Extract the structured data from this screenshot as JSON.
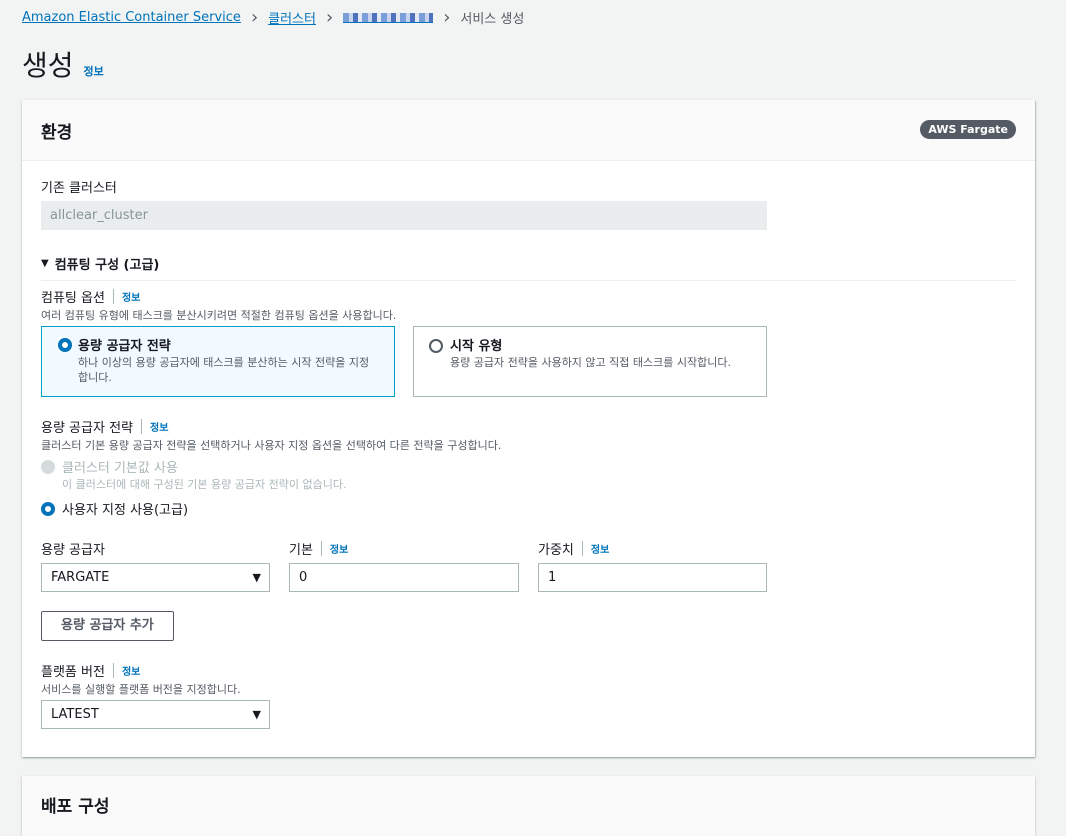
{
  "breadcrumb": {
    "service": "Amazon Elastic Container Service",
    "clusters": "클러스터",
    "current": "서비스 생성"
  },
  "page": {
    "title": "생성",
    "info": "정보"
  },
  "environment": {
    "title": "환경",
    "badge": "AWS Fargate",
    "existing_cluster_label": "기존 클러스터",
    "existing_cluster_value": "allclear_cluster",
    "compute_config_label": "컴퓨팅 구성 (고급)",
    "compute_options": {
      "label": "컴퓨팅 옵션",
      "info": "정보",
      "description": "여러 컴퓨팅 유형에 태스크를 분산시키려면 적절한 컴퓨팅 옵션을 사용합니다.",
      "tiles": [
        {
          "title": "용량 공급자 전략",
          "description": "하나 이상의 용량 공급자에 태스크를 분산하는 시작 전략을 지정합니다.",
          "selected": true
        },
        {
          "title": "시작 유형",
          "description": "용량 공급자 전략을 사용하지 않고 직접 태스크를 시작합니다.",
          "selected": false
        }
      ]
    },
    "capacity_strategy": {
      "label": "용량 공급자 전략",
      "info": "정보",
      "description": "클러스터 기본 용량 공급자 전략을 선택하거나 사용자 지정 옵션을 선택하여 다른 전략을 구성합니다.",
      "option_default": "클러스터 기본값 사용",
      "option_default_desc": "이 클러스터에 대해 구성된 기본 용량 공급자 전략이 없습니다.",
      "option_custom": "사용자 지정 사용(고급)"
    },
    "provider_row": {
      "provider_label": "용량 공급자",
      "provider_value": "FARGATE",
      "base_label": "기본",
      "base_info": "정보",
      "base_value": "0",
      "weight_label": "가중치",
      "weight_info": "정보",
      "weight_value": "1"
    },
    "add_provider_button": "용량 공급자 추가",
    "platform": {
      "label": "플랫폼 버전",
      "info": "정보",
      "description": "서비스를 실행할 플랫폼 버전을 지정합니다.",
      "value": "LATEST"
    }
  },
  "deployment": {
    "title": "배포 구성"
  },
  "colors": {
    "link": "#0073bb",
    "selected_tile_bg": "#f1faff",
    "selected_tile_border": "#00a1c9",
    "badge_bg": "#545b64"
  }
}
